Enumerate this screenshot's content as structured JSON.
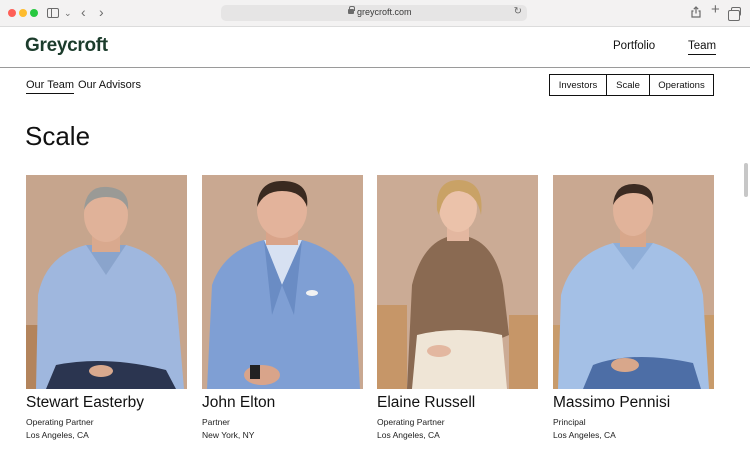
{
  "browser": {
    "url": "greycroft.com"
  },
  "header": {
    "logo": "Greycroft",
    "nav": [
      {
        "label": "Portfolio"
      },
      {
        "label": "Team"
      }
    ]
  },
  "subnav": {
    "tabs": [
      {
        "label": "Our Team"
      },
      {
        "label": "Our Advisors"
      }
    ],
    "filters": [
      {
        "label": "Investors"
      },
      {
        "label": "Scale"
      },
      {
        "label": "Operations"
      }
    ]
  },
  "section": {
    "title": "Scale"
  },
  "people": [
    {
      "name": "Stewart Easterby",
      "role": "Operating Partner",
      "location": "Los Angeles, CA"
    },
    {
      "name": "John Elton",
      "role": "Partner",
      "location": "New York, NY"
    },
    {
      "name": "Elaine Russell",
      "role": "Operating Partner",
      "location": "Los Angeles, CA"
    },
    {
      "name": "Massimo Pennisi",
      "role": "Principal",
      "location": "Los Angeles, CA"
    }
  ],
  "colors": {
    "logo": "#1c3c2c",
    "photo_background": "#c9a891",
    "text": "#111111"
  }
}
